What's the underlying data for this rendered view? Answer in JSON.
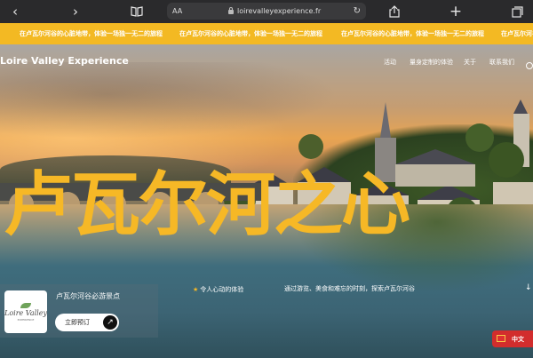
{
  "browser": {
    "aa_label": "AA",
    "url": "loirevalleyexperience.fr",
    "icons": [
      "back-icon",
      "forward-icon",
      "bookmarks-icon",
      "reader-icon",
      "lock-icon",
      "reload-icon",
      "share-icon",
      "new-tab-icon",
      "tabs-icon"
    ]
  },
  "banner": {
    "message": "在卢瓦尔河谷的心脏地带，体验一场独一无二的旅程",
    "color": "#f3b923"
  },
  "header": {
    "brand": "Loire Valley Experience",
    "nav": [
      "活动",
      "量身定制的体验",
      "关于",
      "联系我们"
    ]
  },
  "hero": {
    "title": "卢瓦尔河之心",
    "title_color": "#f6b826"
  },
  "card": {
    "title": "卢瓦尔河谷必游景点",
    "logo_line1": "Loire Valley",
    "logo_line2": "EXPERIENCE",
    "book_label": "立即预订",
    "book_arrow": "↗"
  },
  "features": {
    "star_text": "令人心动的体验",
    "description": "通过游览、美食和难忘的时刻，探索卢瓦尔河谷"
  },
  "language": {
    "label": "中文",
    "flag_color": "#e03131"
  }
}
